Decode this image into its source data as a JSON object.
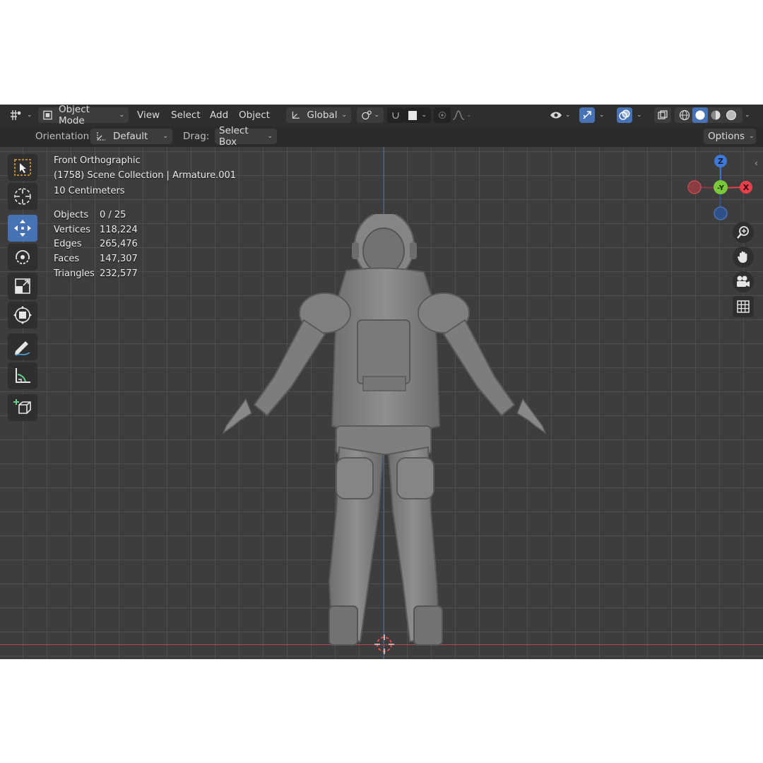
{
  "header": {
    "editor_type_icon": "editor-type-icon",
    "mode_label": "Object Mode",
    "menus": [
      "View",
      "Select",
      "Add",
      "Object"
    ],
    "transform_orientation": "Global",
    "colors": {
      "accent": "#4772b3",
      "header_bg": "#2e2e2e",
      "viewport_bg": "#3d3d3d"
    }
  },
  "toolheader": {
    "orientation_label": "Orientation:",
    "orientation_value": "Default",
    "drag_label": "Drag:",
    "drag_value": "Select Box",
    "options_label": "Options"
  },
  "overlay": {
    "view_name": "Front Orthographic",
    "collection": "(1758) Scene Collection | Armature.001",
    "scale": "10 Centimeters",
    "stats": [
      {
        "label": "Objects",
        "value": "0 / 25"
      },
      {
        "label": "Vertices",
        "value": "118,224"
      },
      {
        "label": "Edges",
        "value": "265,476"
      },
      {
        "label": "Faces",
        "value": "147,307"
      },
      {
        "label": "Triangles",
        "value": "232,577"
      }
    ]
  },
  "gizmo": {
    "z": "Z",
    "y": "-Y",
    "x": "X"
  },
  "toolbar": [
    "select-box",
    "cursor",
    "move",
    "rotate",
    "scale",
    "transform",
    "annotate",
    "measure",
    "add-cube"
  ]
}
